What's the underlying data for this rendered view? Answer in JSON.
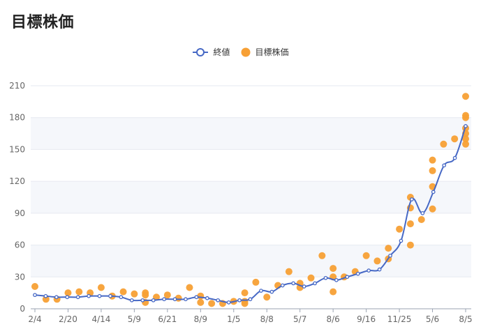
{
  "page": {
    "title": "目標株価"
  },
  "colors": {
    "line": "#4668c5",
    "dots": "#f7a035",
    "band": "#f5f7fb",
    "grid": "#e6e9f0"
  },
  "chart_data": {
    "type": "line",
    "title": "",
    "xlabel": "",
    "ylabel": "",
    "ylim": [
      0,
      210
    ],
    "y_ticks": [
      "210",
      "180",
      "150",
      "120",
      "90",
      "60",
      "30",
      "0"
    ],
    "y_tick_values": [
      210,
      180,
      150,
      120,
      90,
      60,
      30,
      0
    ],
    "x_tick_labels": [
      "2/4",
      "2/20",
      "4/14",
      "5/9",
      "6/21",
      "8/9",
      "1/5",
      "8/8",
      "5/7",
      "8/6",
      "9/16",
      "11/25",
      "5/6",
      "8/5"
    ],
    "x_tick_index": [
      0,
      3,
      6,
      9,
      12,
      15,
      18,
      21,
      24,
      27,
      30,
      33,
      36,
      39
    ],
    "x_count": 40,
    "grid": true,
    "legend_position": "top-center",
    "series": [
      {
        "name": "終値",
        "values": [
          13,
          12,
          11,
          11,
          11,
          12,
          12,
          12,
          11,
          8,
          8,
          8,
          9,
          9,
          9,
          11,
          10,
          8,
          6,
          8,
          9,
          17,
          16,
          22,
          24,
          21,
          24,
          29,
          27,
          30,
          33,
          36,
          37,
          50,
          64,
          103,
          90,
          110,
          135,
          142,
          172
        ]
      },
      {
        "name": "目標株価",
        "points": [
          [
            0,
            21
          ],
          [
            1,
            9
          ],
          [
            2,
            9
          ],
          [
            3,
            15
          ],
          [
            4,
            16
          ],
          [
            5,
            15
          ],
          [
            6,
            20
          ],
          [
            7,
            12
          ],
          [
            8,
            16
          ],
          [
            9,
            14
          ],
          [
            10,
            15
          ],
          [
            10,
            13
          ],
          [
            10,
            6
          ],
          [
            11,
            11
          ],
          [
            12,
            13
          ],
          [
            13,
            10
          ],
          [
            14,
            20
          ],
          [
            15,
            12
          ],
          [
            15,
            6
          ],
          [
            16,
            5
          ],
          [
            17,
            5
          ],
          [
            18,
            7
          ],
          [
            19,
            7
          ],
          [
            19,
            5
          ],
          [
            19,
            15
          ],
          [
            20,
            25
          ],
          [
            21,
            11
          ],
          [
            22,
            22
          ],
          [
            23,
            35
          ],
          [
            24,
            24
          ],
          [
            24,
            20
          ],
          [
            25,
            29
          ],
          [
            26,
            50
          ],
          [
            27,
            38
          ],
          [
            27,
            30
          ],
          [
            27,
            16
          ],
          [
            28,
            30
          ],
          [
            29,
            35
          ],
          [
            30,
            50
          ],
          [
            31,
            45
          ],
          [
            32,
            57
          ],
          [
            32,
            47
          ],
          [
            33,
            75
          ],
          [
            34,
            105
          ],
          [
            34,
            95
          ],
          [
            34,
            80
          ],
          [
            34,
            60
          ],
          [
            35,
            84
          ],
          [
            36,
            140
          ],
          [
            36,
            130
          ],
          [
            36,
            115
          ],
          [
            36,
            94
          ],
          [
            37,
            155
          ],
          [
            38,
            160
          ],
          [
            39,
            200
          ],
          [
            39,
            182
          ],
          [
            39,
            180
          ],
          [
            39,
            170
          ],
          [
            39,
            165
          ],
          [
            39,
            160
          ],
          [
            39,
            155
          ]
        ]
      }
    ]
  }
}
